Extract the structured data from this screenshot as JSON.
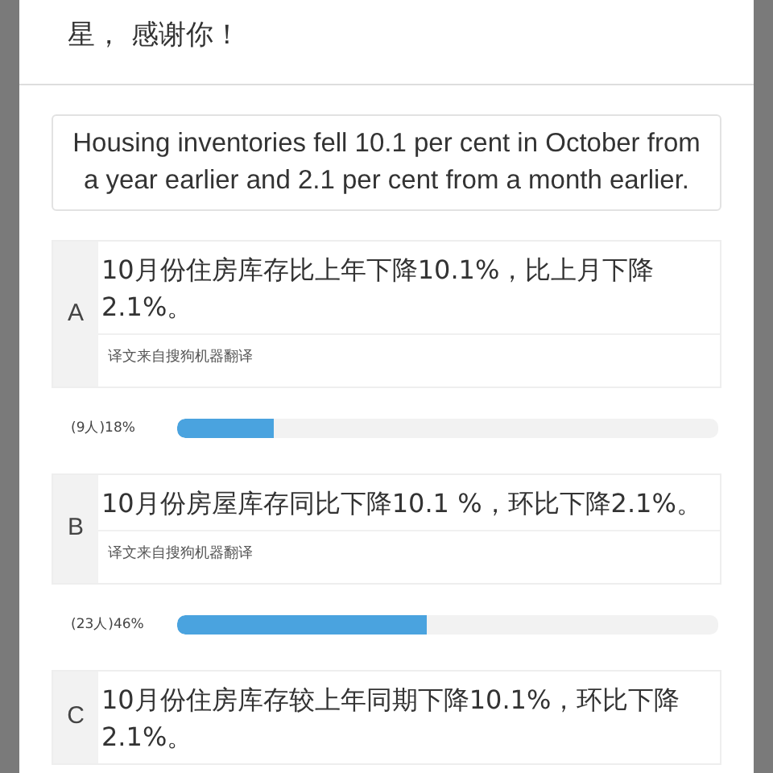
{
  "post": {
    "text": "星， 感谢你！"
  },
  "question": {
    "text": "Housing inventories fell 10.1 per cent in October from a year earlier and 2.1 per cent from a month earlier."
  },
  "options": [
    {
      "letter": "A",
      "text": "10月份住房库存比上年下降10.1%，比上月下降2.1%。",
      "translation_note": "译文来自搜狗机器翻译",
      "votes": "(9人)18%",
      "level": 0.18
    },
    {
      "letter": "B",
      "text": "10月份房屋库存同比下降10.1 %，环比下降2.1%。",
      "translation_note": "译文来自搜狗机器翻译",
      "votes": "(23人)46%",
      "level": 0.46
    },
    {
      "letter": "C",
      "text": "10月份住房库存较上年同期下降10.1%，环比下降2.1%。"
    }
  ]
}
